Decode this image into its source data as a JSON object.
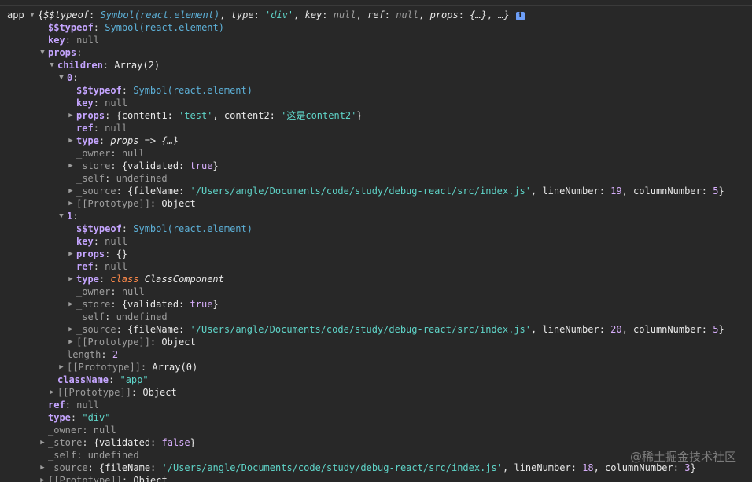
{
  "console": {
    "header": {
      "label": "app",
      "summary_open": "{",
      "summary_key1": "$$typeof",
      "summary_val1": "Symbol(react.element)",
      "summary_key2": "type",
      "summary_val2": "'div'",
      "summary_key3": "key",
      "summary_val3": "null",
      "summary_key4": "ref",
      "summary_val4": "null",
      "summary_key5": "props",
      "summary_val5": "{…}",
      "summary_tail": "…}",
      "info_icon": "i"
    },
    "lines": {
      "l1_key": "$$typeof",
      "l1_val": "Symbol(react.element)",
      "l2_key": "key",
      "l2_val": "null",
      "l3_key": "props",
      "l4_key": "children",
      "l4_val": "Array(2)",
      "l5_key": "0",
      "c0_typeof_key": "$$typeof",
      "c0_typeof_val": "Symbol(react.element)",
      "c0_key_key": "key",
      "c0_key_val": "null",
      "c0_props_key": "props",
      "c0_props_open": "{content1: ",
      "c0_props_v1": "'test'",
      "c0_props_mid": ", content2: ",
      "c0_props_v2": "'这是content2'",
      "c0_props_close": "}",
      "c0_ref_key": "ref",
      "c0_ref_val": "null",
      "c0_type_key": "type",
      "c0_type_val": "props => {…}",
      "c0_owner_key": "_owner",
      "c0_owner_val": "null",
      "c0_store_key": "_store",
      "c0_store_open": "{validated: ",
      "c0_store_bool": "true",
      "c0_store_close": "}",
      "c0_self_key": "_self",
      "c0_self_val": "undefined",
      "c0_source_key": "_source",
      "c0_source_open": "{fileName: ",
      "c0_source_file": "'/Users/angle/Documents/code/study/debug-react/src/index.js'",
      "c0_source_mid": ", lineNumber: ",
      "c0_source_line": "19",
      "c0_source_mid2": ", columnNumber: ",
      "c0_source_col": "5",
      "c0_source_close": "}",
      "c0_proto_key": "[[Prototype]]",
      "c0_proto_val": "Object",
      "l6_key": "1",
      "c1_typeof_key": "$$typeof",
      "c1_typeof_val": "Symbol(react.element)",
      "c1_key_key": "key",
      "c1_key_val": "null",
      "c1_props_key": "props",
      "c1_props_val": "{}",
      "c1_ref_key": "ref",
      "c1_ref_val": "null",
      "c1_type_key": "type",
      "c1_type_kw": "class",
      "c1_type_name": "ClassComponent",
      "c1_owner_key": "_owner",
      "c1_owner_val": "null",
      "c1_store_key": "_store",
      "c1_store_open": "{validated: ",
      "c1_store_bool": "true",
      "c1_store_close": "}",
      "c1_self_key": "_self",
      "c1_self_val": "undefined",
      "c1_source_key": "_source",
      "c1_source_open": "{fileName: ",
      "c1_source_file": "'/Users/angle/Documents/code/study/debug-react/src/index.js'",
      "c1_source_mid": ", lineNumber: ",
      "c1_source_line": "20",
      "c1_source_mid2": ", columnNumber: ",
      "c1_source_col": "5",
      "c1_source_close": "}",
      "c1_proto_key": "[[Prototype]]",
      "c1_proto_val": "Object",
      "len_key": "length",
      "len_val": "2",
      "arr_proto_key": "[[Prototype]]",
      "arr_proto_val": "Array(0)",
      "cls_key": "className",
      "cls_val": "\"app\"",
      "props_proto_key": "[[Prototype]]",
      "props_proto_val": "Object",
      "ref_key": "ref",
      "ref_val": "null",
      "type_key": "type",
      "type_val": "\"div\"",
      "owner_key": "_owner",
      "owner_val": "null",
      "store_key": "_store",
      "store_open": "{validated: ",
      "store_bool": "false",
      "store_close": "}",
      "self_key": "_self",
      "self_val": "undefined",
      "source_key": "_source",
      "source_open": "{fileName: ",
      "source_file": "'/Users/angle/Documents/code/study/debug-react/src/index.js'",
      "source_mid": ", lineNumber: ",
      "source_line": "18",
      "source_mid2": ", columnNumber: ",
      "source_col": "3",
      "source_close": "}",
      "proto_key": "[[Prototype]]",
      "proto_val": "Object"
    }
  },
  "watermark": "@稀土掘金技术社区",
  "colors": {
    "background": "#282828",
    "key": "#c5a5ff",
    "string": "#5fd4c8",
    "symbol": "#5db0d7",
    "null": "#9e9e9e",
    "bool_num": "#d7aefb",
    "keyword": "#ff8a4a",
    "info_icon": "#6d9ef7"
  }
}
